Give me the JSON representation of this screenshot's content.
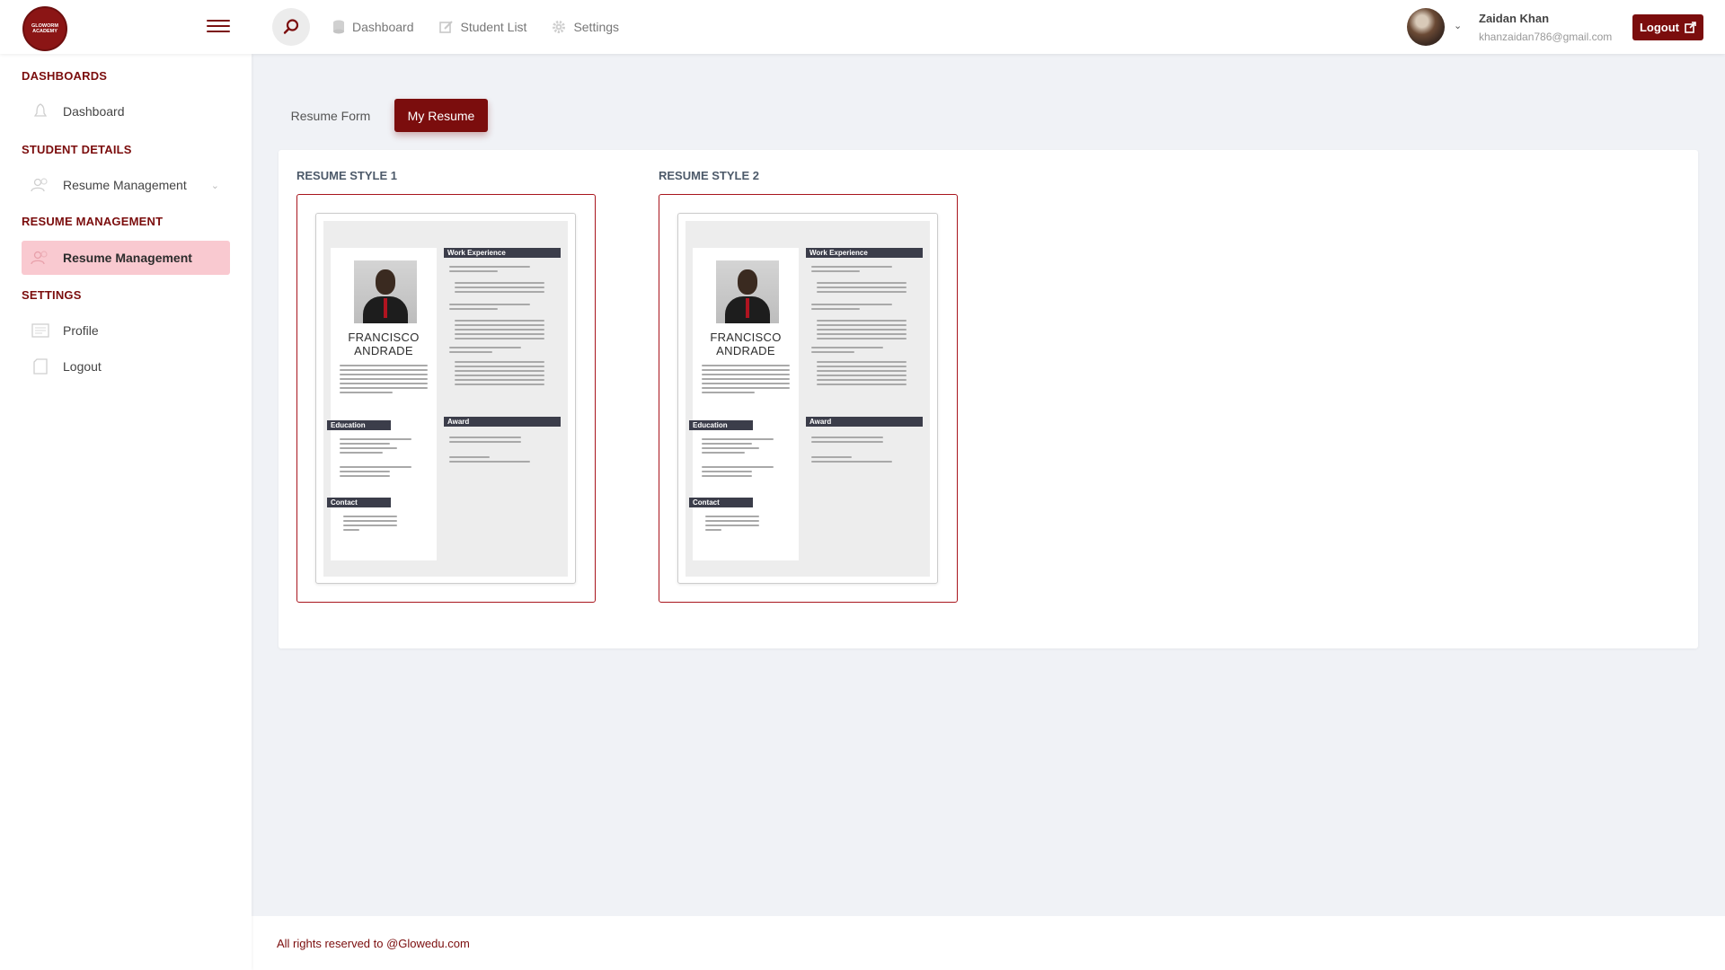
{
  "header": {
    "logo_text": "GLOWORM ACADEMY",
    "nav": [
      {
        "label": "Dashboard",
        "icon": "database-icon"
      },
      {
        "label": "Student List",
        "icon": "edit-icon"
      },
      {
        "label": "Settings",
        "icon": "gear-icon"
      }
    ],
    "user": {
      "name": "Zaidan Khan",
      "email": "khanzaidan786@gmail.com"
    },
    "logout_label": "Logout"
  },
  "sidebar": {
    "sections": [
      {
        "title": "DASHBOARDS",
        "items": [
          {
            "label": "Dashboard",
            "icon": "bell-icon"
          }
        ]
      },
      {
        "title": "STUDENT DETAILS",
        "items": [
          {
            "label": "Resume Management",
            "icon": "users-icon",
            "has_caret": true
          }
        ]
      },
      {
        "title": "RESUME MANAGEMENT",
        "items": [
          {
            "label": "Resume Management",
            "icon": "users-icon",
            "active": true
          }
        ]
      },
      {
        "title": "SETTINGS",
        "items": [
          {
            "label": "Profile",
            "icon": "profile-icon"
          },
          {
            "label": "Logout",
            "icon": "logout-icon"
          }
        ]
      }
    ]
  },
  "tabs": [
    {
      "label": "Resume Form",
      "active": false
    },
    {
      "label": "My Resume",
      "active": true
    }
  ],
  "resumes": [
    {
      "title": "RESUME STYLE 1",
      "preview": {
        "first_name": "FRANCISCO",
        "last_name": "ANDRADE",
        "sections_left": [
          "Education",
          "Contact"
        ],
        "sections_right": [
          "Work Experience",
          "Award"
        ]
      }
    },
    {
      "title": "RESUME STYLE 2",
      "preview": {
        "first_name": "FRANCISCO",
        "last_name": "ANDRADE",
        "sections_left": [
          "Education",
          "Contact"
        ],
        "sections_right": [
          "Work Experience",
          "Award"
        ]
      }
    }
  ],
  "footer": {
    "text": "All rights reserved to @Glowedu.com"
  },
  "colors": {
    "accent": "#7b0d0d",
    "active_bg": "#f9c9d0",
    "background": "#f0f2f6"
  }
}
